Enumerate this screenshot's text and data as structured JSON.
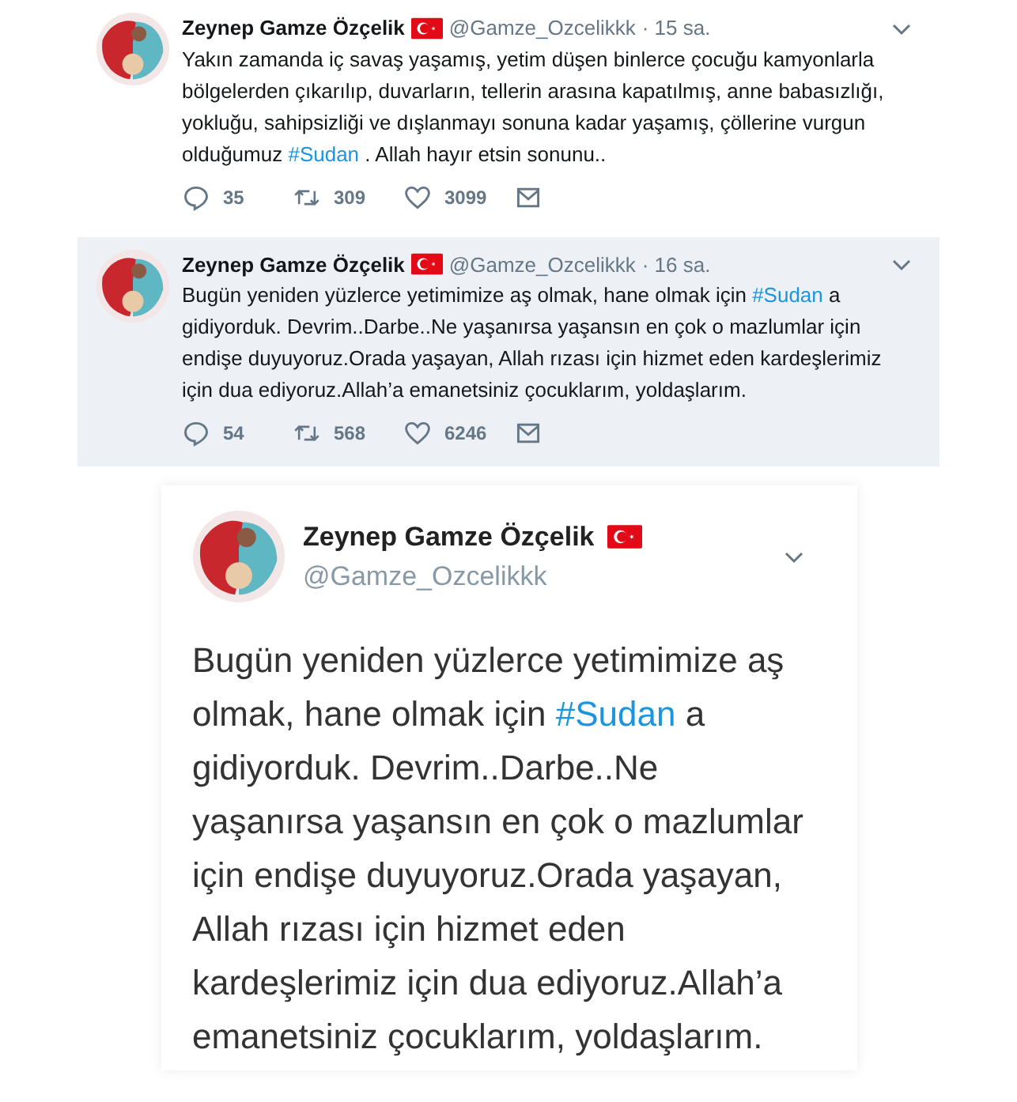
{
  "tweets": [
    {
      "name": "Zeynep Gamze Özçelik",
      "handle": "@Gamze_Ozcelikkk",
      "time": "· 15 sa.",
      "text_before": "Yakın zamanda iç savaş yaşamış, yetim düşen binlerce çocuğu kamyonlarla bölgelerden çıkarılıp, duvarların, tellerin arasına kapatılmış, anne babasızlığı, yokluğu, sahipsizliği ve dışlanmayı sonuna kadar yaşamış, çöllerine vurgun olduğumuz ",
      "hashtag": "#Sudan",
      "text_after": " . Allah hayır etsin sonunu..",
      "replies": "35",
      "retweets": "309",
      "likes": "3099",
      "selected": false
    },
    {
      "name": "Zeynep Gamze Özçelik",
      "handle": "@Gamze_Ozcelikkk",
      "time": "· 16 sa.",
      "text_before": "Bugün yeniden yüzlerce yetimimize aş olmak, hane olmak için ",
      "hashtag": "#Sudan",
      "text_after": " a gidiyorduk. Devrim..Darbe..Ne yaşanırsa yaşansın en çok o mazlumlar için endişe duyuyoruz.Orada yaşayan, Allah rızası için hizmet eden kardeşlerimiz için dua ediyoruz.Allah’a emanetsiniz çocuklarım, yoldaşlarım.",
      "replies": "54",
      "retweets": "568",
      "likes": "6246",
      "selected": true
    }
  ],
  "mobile_screenshot": {
    "name": "Zeynep Gamze Özçelik",
    "handle": "@Gamze_Ozcelikkk",
    "text_before": "Bugün yeniden yüzlerce yetimimize aş olmak, hane olmak için ",
    "hashtag": "#Sudan",
    "text_after": " a gidiyorduk. Devrim..Darbe..Ne yaşanırsa yaşansın en çok o mazlumlar için endişe duyuyoruz.Orada yaşayan, Allah rızası için hizmet eden kardeşlerimiz için dua ediyoruz.Allah’a emanetsiniz çocuklarım, yoldaşlarım."
  }
}
